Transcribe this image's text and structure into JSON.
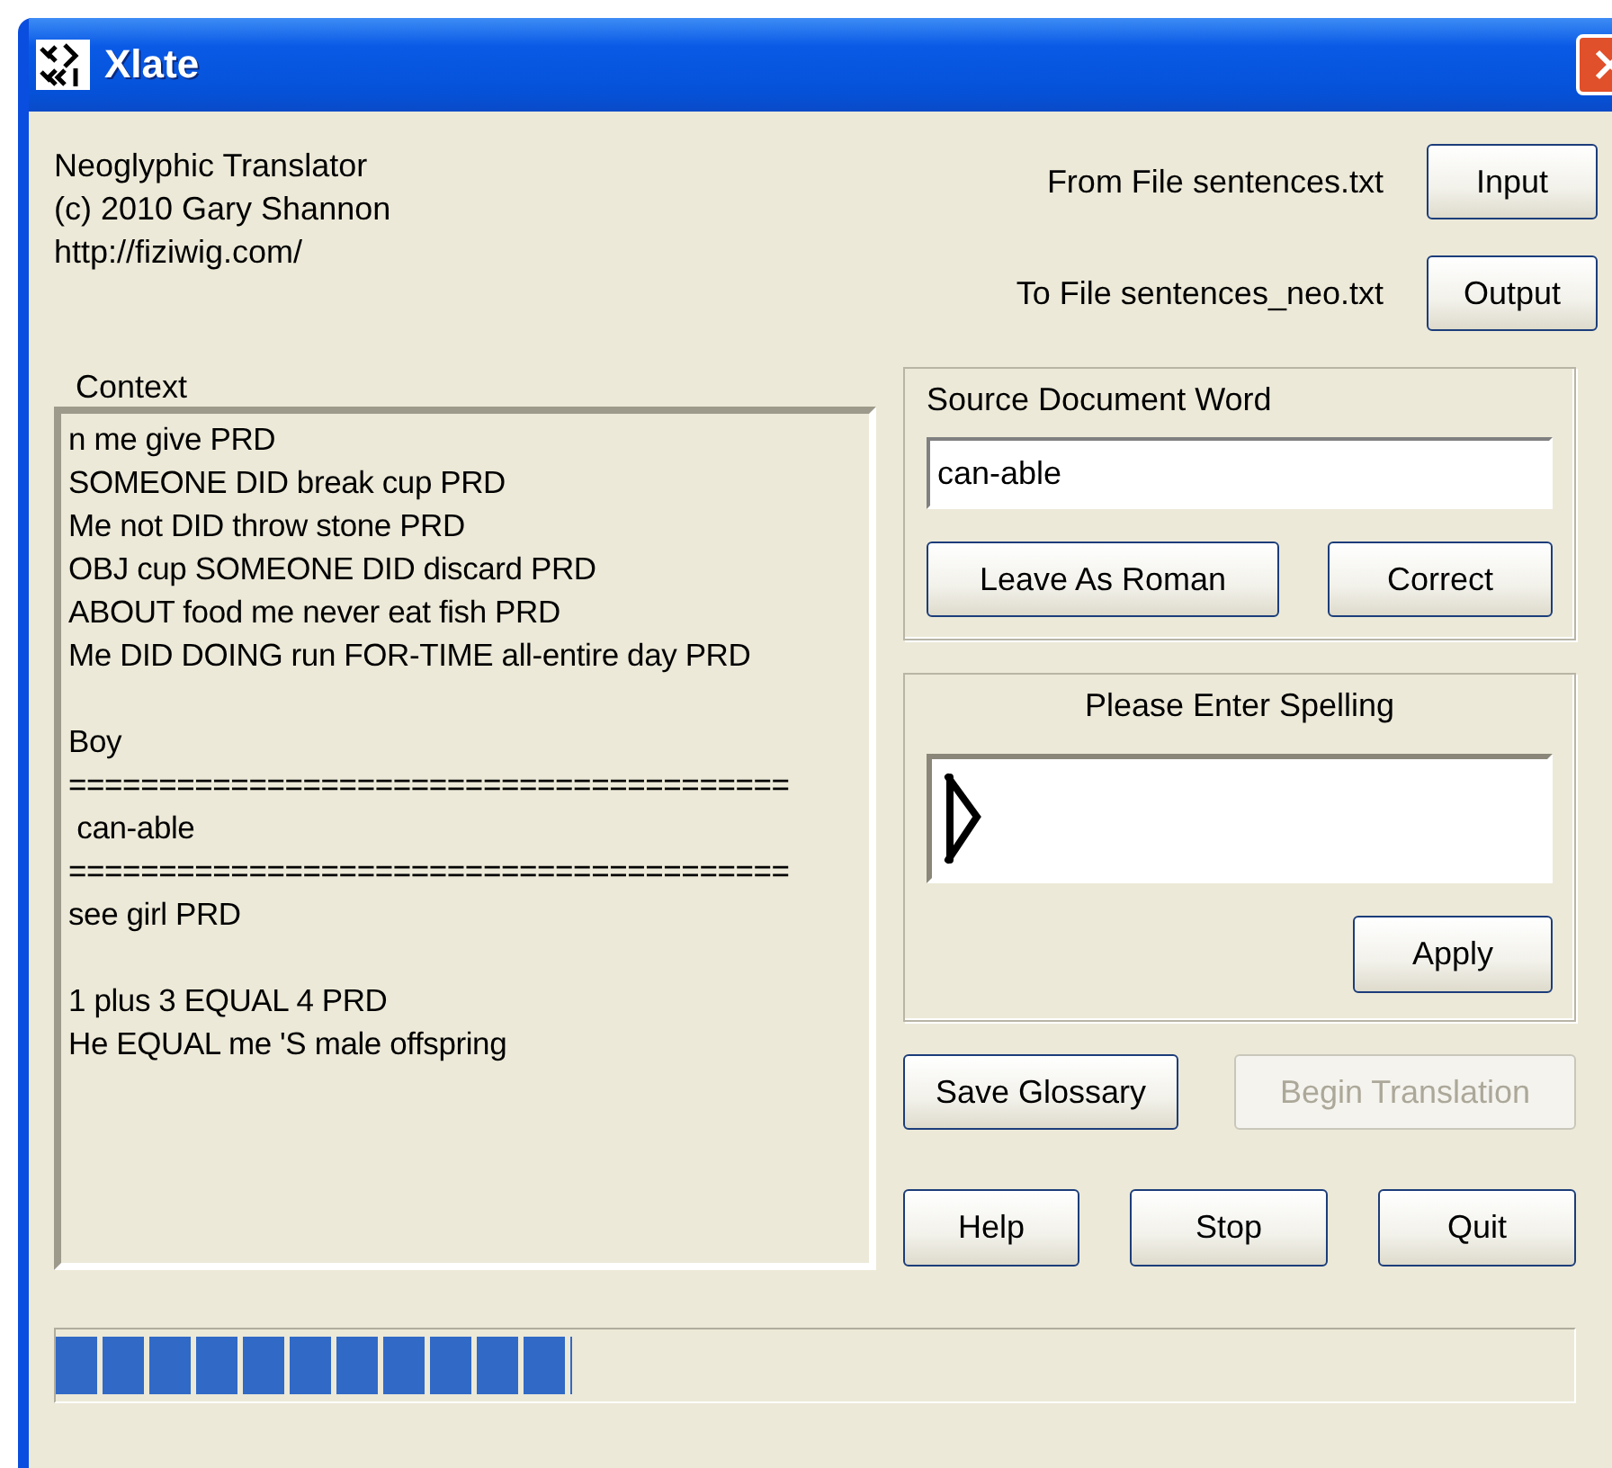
{
  "window": {
    "title": "Xlate"
  },
  "about": [
    "Neoglyphic Translator",
    "(c) 2010 Gary Shannon",
    "http://fiziwig.com/"
  ],
  "files": [
    {
      "label": "From File sentences.txt",
      "button": "Input"
    },
    {
      "label": "To File sentences_neo.txt",
      "button": "Output"
    }
  ],
  "context": {
    "label": "Context",
    "blocks": [
      [
        "n me give PRD",
        "SOMEONE DID break cup PRD",
        "Me not DID throw stone PRD",
        "OBJ cup SOMEONE DID discard PRD",
        "ABOUT food me never eat fish PRD",
        "Me DID DOING run FOR-TIME all-entire day PRD"
      ],
      [
        "Boy",
        "========================================",
        " can-able",
        "========================================",
        "see girl PRD"
      ],
      [
        "1 plus 3 EQUAL 4 PRD",
        "He EQUAL me 'S male offspring"
      ]
    ]
  },
  "source": {
    "title": "Source Document Word",
    "value": "can-able",
    "buttons": [
      "Leave As Roman",
      "Correct"
    ]
  },
  "spelling": {
    "title": "Please Enter Spelling",
    "button": "Apply"
  },
  "actions": [
    {
      "label": "Save Glossary",
      "disabled": false
    },
    {
      "label": "Begin Translation",
      "disabled": true
    }
  ],
  "controls": [
    "Help",
    "Stop",
    "Quit"
  ],
  "progress": {
    "level": 0.34
  }
}
